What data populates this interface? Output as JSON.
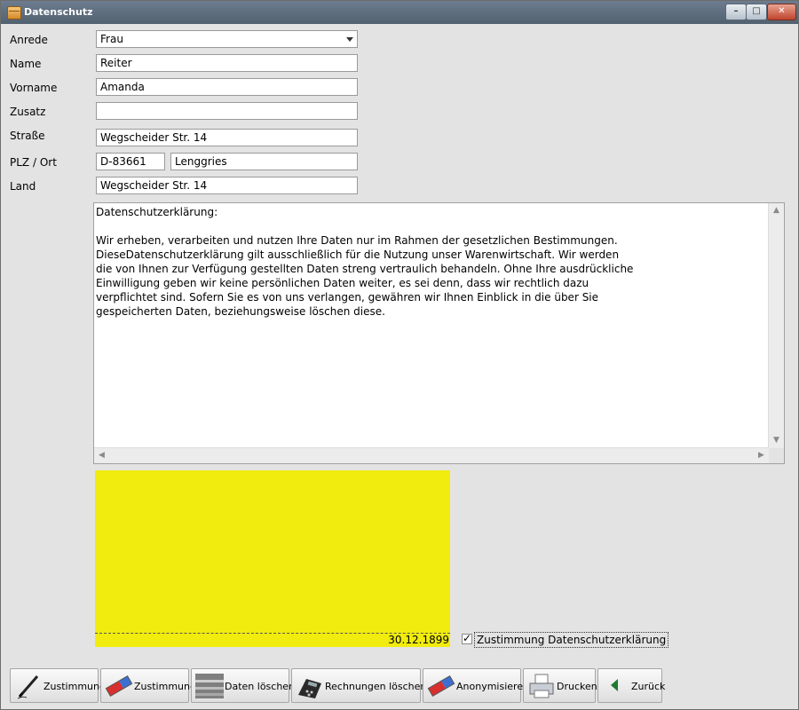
{
  "window": {
    "title": "Datenschutz"
  },
  "form": {
    "anrede": {
      "label": "Anrede",
      "value": "Frau"
    },
    "name": {
      "label": "Name",
      "value": "Reiter"
    },
    "vorname": {
      "label": "Vorname",
      "value": "Amanda"
    },
    "zusatz": {
      "label": "Zusatz",
      "value": ""
    },
    "strasse": {
      "label": "Straße",
      "value": "Wegscheider Str. 14"
    },
    "plz_ort": {
      "label": "PLZ / Ort",
      "plz": "D-83661",
      "ort": "Lenggries"
    },
    "land": {
      "label": "Land",
      "value": "Wegscheider Str. 14"
    }
  },
  "memo": {
    "text": "Datenschutzerklärung:\n\nWir erheben, verarbeiten und nutzen Ihre Daten nur im Rahmen der gesetzlichen Bestimmungen.\nDieseDatenschutzerklärung gilt ausschließlich für die Nutzung unser Warenwirtschaft. Wir werden\ndie von Ihnen zur Verfügung gestellten Daten streng vertraulich behandeln. Ohne Ihre ausdrückliche\nEinwilligung geben wir keine persönlichen Daten weiter, es sei denn, dass wir rechtlich dazu\nverpflichtet sind. Sofern Sie es von uns verlangen, gewähren wir Ihnen Einblick in die über Sie\ngespeicherten Daten, beziehungsweise löschen diese."
  },
  "signature": {
    "date": "30.12.1899",
    "background": "#f1ec0d"
  },
  "consent": {
    "label": "Zustimmung Datenschutzerklärung",
    "checked": true
  },
  "toolbar": {
    "buttons": [
      {
        "label": "Zustimmung",
        "icon": "pen-icon"
      },
      {
        "label": "Zustimmung",
        "icon": "eraser-icon"
      },
      {
        "label": "Daten löschen",
        "icon": "shredder-icon"
      },
      {
        "label": "Rechnungen  löschen",
        "icon": "calculator-icon"
      },
      {
        "label": "Anonymisieren",
        "icon": "eraser-icon"
      },
      {
        "label": "Drucken",
        "icon": "printer-icon"
      },
      {
        "label": "Zurück",
        "icon": "back-arrow-icon"
      }
    ]
  }
}
